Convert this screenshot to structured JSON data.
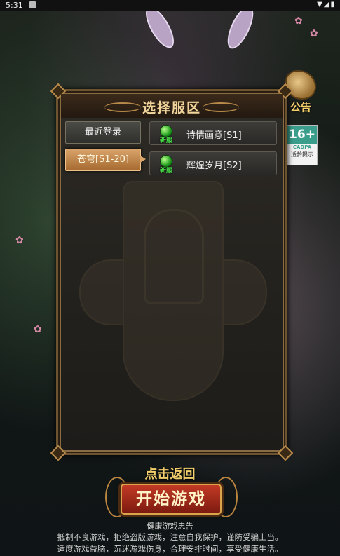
{
  "status_bar": {
    "time": "5:31",
    "icons": "▼◢▮"
  },
  "side": {
    "notice_label": "公告",
    "age_rating": {
      "num": "16+",
      "org": "CADPA",
      "tip": "适龄提示"
    }
  },
  "panel": {
    "title": "选择服区",
    "recent_label": "最近登录",
    "group_label": "苍穹[S1-20]",
    "servers": [
      {
        "name": "诗情画意[S1]",
        "tag": "新服",
        "status_color": "#2fbf2f"
      },
      {
        "name": "辉煌岁月[S2]",
        "tag": "新服",
        "status_color": "#2fbf2f"
      }
    ]
  },
  "footer": {
    "back_label": "点击返回",
    "start_label": "开始游戏",
    "health_title": "健康游戏忠告",
    "health_lines": [
      "抵制不良游戏，拒绝盗版游戏，注意自我保护，谨防受骗上当。",
      "适度游戏益脑，沉迷游戏伤身，合理安排时间，享受健康生活。"
    ]
  }
}
